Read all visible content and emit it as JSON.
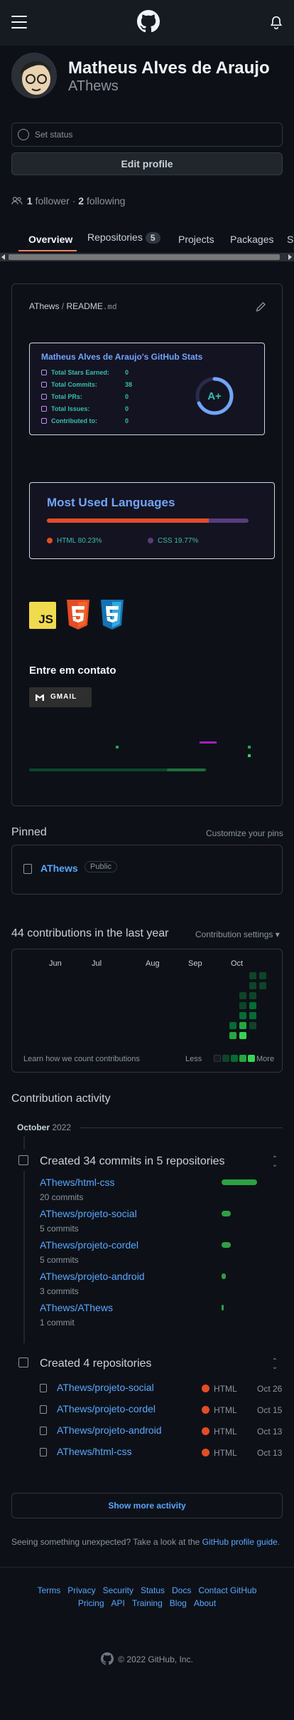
{
  "header": {
    "menu_icon": "hamburger-icon",
    "logo_icon": "github-mark-icon",
    "bell_icon": "bell-icon"
  },
  "profile": {
    "full_name": "Matheus Alves de Araujo",
    "login": "AThews",
    "status_placeholder": "Set status",
    "edit_label": "Edit profile",
    "followers_count": "1",
    "followers_label": "follower",
    "separator": "·",
    "following_count": "2",
    "following_label": "following"
  },
  "tabs": [
    {
      "label": "Overview",
      "active": true
    },
    {
      "label": "Repositories",
      "count": "5"
    },
    {
      "label": "Projects"
    },
    {
      "label": "Packages"
    },
    {
      "label": "Stars"
    }
  ],
  "readme": {
    "owner": "AThews",
    "separator": " / ",
    "file": "README",
    "ext": ".md",
    "stats_card": {
      "title": "Matheus Alves de Araujo's GitHub Stats",
      "rows": [
        {
          "label": "Total Stars Earned:",
          "value": "0"
        },
        {
          "label": "Total Commits:",
          "value": "38"
        },
        {
          "label": "Total PRs:",
          "value": "0"
        },
        {
          "label": "Total Issues:",
          "value": "0"
        },
        {
          "label": "Contributed to:",
          "value": "0"
        }
      ],
      "grade": "A+",
      "grade_ring_fill": 0.68
    },
    "languages_card": {
      "title": "Most Used Languages",
      "langs": [
        {
          "name": "HTML",
          "percent": "80.23%",
          "share": 0.8023,
          "color": "#e34c26"
        },
        {
          "name": "CSS",
          "percent": "19.77%",
          "share": 0.1977,
          "color": "#563d7c"
        }
      ]
    },
    "tech_icons": [
      "javascript-icon",
      "html5-icon",
      "css3-icon"
    ],
    "tech_labels": {
      "js": "JS"
    },
    "contact_title": "Entre em contato",
    "gmail_label": "GMAIL"
  },
  "pinned": {
    "title": "Pinned",
    "customize_label": "Customize your pins",
    "repo": {
      "name": "AThews",
      "visibility": "Public"
    }
  },
  "contributions": {
    "title": "44 contributions in the last year",
    "settings_label": "Contribution settings",
    "months": [
      "Jun",
      "Jul",
      "Aug",
      "Sep",
      "Oct"
    ],
    "learn_label": "Learn how we count contributions",
    "less_label": "Less",
    "more_label": "More",
    "colors": [
      "#161b22",
      "#0e4429",
      "#006d32",
      "#26a641",
      "#39d353"
    ]
  },
  "activity": {
    "title": "Contribution activity",
    "month": "October",
    "year": "2022",
    "commits": {
      "heading": "Created 34 commits in 5 repositories",
      "repos": [
        {
          "name": "AThews/html-css",
          "count": "20 commits",
          "share": 1.0
        },
        {
          "name": "AThews/projeto-social",
          "count": "5 commits",
          "share": 0.25
        },
        {
          "name": "AThews/projeto-cordel",
          "count": "5 commits",
          "share": 0.25
        },
        {
          "name": "AThews/projeto-android",
          "count": "3 commits",
          "share": 0.12
        },
        {
          "name": "AThews/AThews",
          "count": "1 commit",
          "share": 0.04
        }
      ]
    },
    "created": {
      "heading": "Created 4 repositories",
      "repos": [
        {
          "name": "AThews/projeto-social",
          "lang": "HTML",
          "date": "Oct 26"
        },
        {
          "name": "AThews/projeto-cordel",
          "lang": "HTML",
          "date": "Oct 15"
        },
        {
          "name": "AThews/projeto-android",
          "lang": "HTML",
          "date": "Oct 13"
        },
        {
          "name": "AThews/html-css",
          "lang": "HTML",
          "date": "Oct 13"
        }
      ]
    },
    "show_more": "Show more activity",
    "unexpected_text": "Seeing something unexpected? Take a look at the ",
    "guide_link": "GitHub profile guide",
    "guide_end": "."
  },
  "footer": {
    "links_row1": [
      "Terms",
      "Privacy",
      "Security",
      "Status",
      "Docs",
      "Contact GitHub"
    ],
    "links_row2": [
      "Pricing",
      "API",
      "Training",
      "Blog",
      "About"
    ],
    "copyright": "© 2022 GitHub, Inc."
  }
}
